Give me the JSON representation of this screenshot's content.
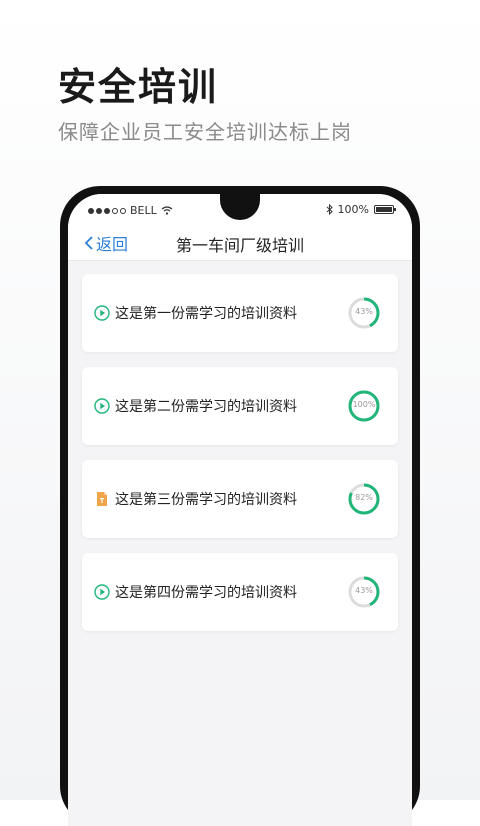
{
  "hero": {
    "title": "安全培训",
    "subtitle": "保障企业员工安全培训达标上岗"
  },
  "statusbar": {
    "carrier": "BELL",
    "battery": "100%",
    "icons": [
      "signal-dots-icon",
      "wifi-icon",
      "bluetooth-icon",
      "battery-icon"
    ]
  },
  "nav": {
    "back_label": "返回",
    "title": "第一车间厂级培训"
  },
  "materials": [
    {
      "title": "这是第一份需学习的培训资料",
      "icon": "play-icon",
      "progress": 43,
      "progress_label": "43%"
    },
    {
      "title": "这是第二份需学习的培训资料",
      "icon": "play-icon",
      "progress": 100,
      "progress_label": "100%"
    },
    {
      "title": "这是第三份需学习的培训资料",
      "icon": "document-icon",
      "progress": 82,
      "progress_label": "82%"
    },
    {
      "title": "这是第四份需学习的培训资料",
      "icon": "play-icon",
      "progress": 43,
      "progress_label": "43%"
    }
  ],
  "colors": {
    "accent_green": "#21b57a",
    "ring_track": "#dcdcdc",
    "back_blue": "#2b7fd8",
    "doc_orange": "#f0a54a"
  }
}
